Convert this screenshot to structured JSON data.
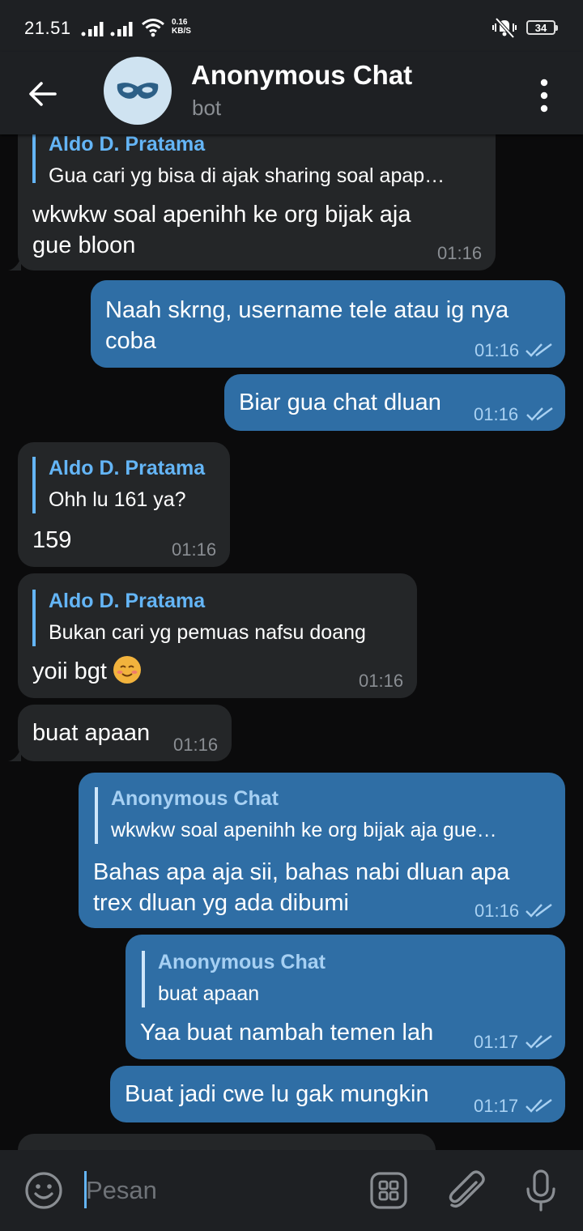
{
  "status_bar": {
    "time": "21.51",
    "network_speed_value": "0.16",
    "network_speed_unit": "KB/S",
    "battery": "34"
  },
  "header": {
    "title": "Anonymous Chat",
    "subtitle": "bot",
    "avatar_icon": "mask-icon"
  },
  "messages": [
    {
      "dir": "in",
      "reply_name": "Aldo D. Pratama",
      "reply_text": "Gua cari yg bisa di ajak sharing soal apap…",
      "text_line1": "wkwkw soal apenihh ke org bijak aja",
      "text_line2": "gue bloon",
      "time": "01:16"
    },
    {
      "dir": "out",
      "text_line1": "Naah skrng, username tele atau ig nya",
      "text_line2": "coba",
      "time": "01:16",
      "status": "read"
    },
    {
      "dir": "out",
      "text": "Biar gua chat dluan",
      "time": "01:16",
      "status": "read"
    },
    {
      "dir": "in",
      "reply_name": "Aldo D. Pratama",
      "reply_text": "Ohh lu 161 ya?",
      "text": "159",
      "time": "01:16"
    },
    {
      "dir": "in",
      "reply_name": "Aldo D. Pratama",
      "reply_text": "Bukan cari yg pemuas nafsu doang",
      "text": "yoii bgt",
      "emoji": "smiling-face-emoji",
      "time": "01:16"
    },
    {
      "dir": "in",
      "text": "buat apaan",
      "time": "01:16"
    },
    {
      "dir": "out",
      "reply_name": "Anonymous Chat",
      "reply_text": "wkwkw soal apenihh ke org bijak aja gue…",
      "text_line1": "Bahas apa aja sii, bahas nabi dluan apa",
      "text_line2": "trex dluan yg ada dibumi",
      "time": "01:16",
      "status": "read"
    },
    {
      "dir": "out",
      "reply_name": "Anonymous Chat",
      "reply_text": "buat apaan",
      "text": "Yaa buat nambah temen lah",
      "time": "01:17",
      "status": "read"
    },
    {
      "dir": "out",
      "text": "Buat jadi cwe lu gak mungkin",
      "time": "01:17",
      "status": "read"
    }
  ],
  "input": {
    "placeholder": "Pesan",
    "value": ""
  },
  "icons": {
    "emoji": "smiley-icon",
    "sticker": "sticker-grid-icon",
    "attach": "paperclip-icon",
    "mic": "microphone-icon"
  },
  "colors": {
    "incoming_bubble": "#242628",
    "outgoing_bubble": "#2f6ea5",
    "accent": "#64b5f6",
    "bar": "#1e2023",
    "background": "#0b0b0c"
  }
}
